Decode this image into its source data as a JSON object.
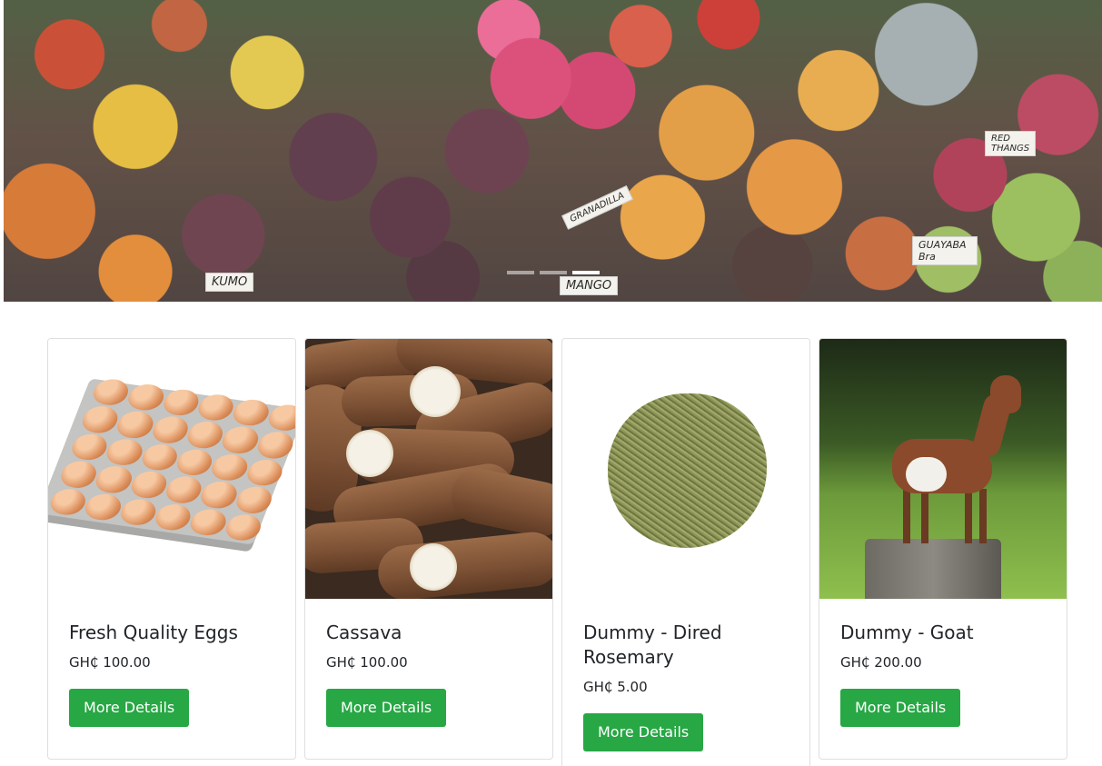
{
  "hero": {
    "tags": [
      "KUMO",
      "MANGO",
      "GRANADILLA",
      "RED THANGS",
      "GUAYABA Bra"
    ],
    "slides": 3,
    "active_slide": 1
  },
  "products": [
    {
      "title": "Fresh Quality Eggs",
      "price": "GH₵ 100.00",
      "button": "More Details"
    },
    {
      "title": "Cassava",
      "price": "GH₵ 100.00",
      "button": "More Details"
    },
    {
      "title": "Dummy - Dired Rosemary",
      "price": "GH₵ 5.00",
      "button": "More Details"
    },
    {
      "title": "Dummy - Goat",
      "price": "GH₵ 200.00",
      "button": "More Details"
    }
  ],
  "colors": {
    "button": "#28a745",
    "button_text": "#ffffff",
    "card_border": "#dfdfdf"
  }
}
